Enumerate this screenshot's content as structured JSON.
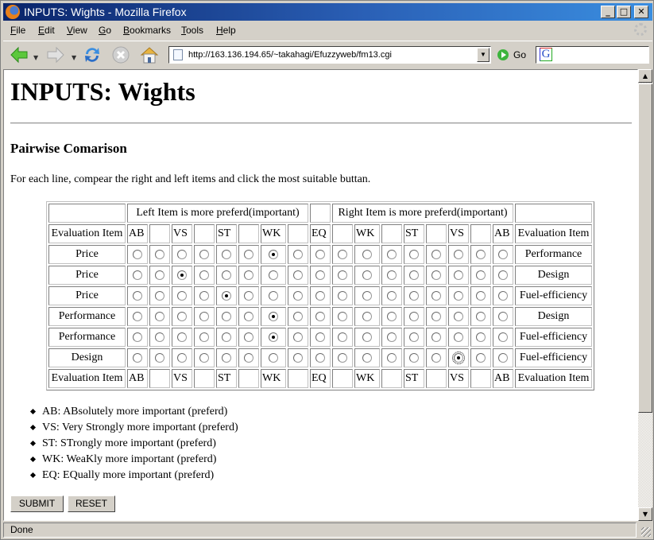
{
  "window": {
    "title": "INPUTS: Wights - Mozilla Firefox",
    "controls": {
      "minimize": "_",
      "maximize": "□",
      "close": "✕"
    }
  },
  "menu": [
    "File",
    "Edit",
    "View",
    "Go",
    "Bookmarks",
    "Tools",
    "Help"
  ],
  "toolbar": {
    "url": "http://163.136.194.65/~takahagi/Efuzzyweb/fm13.cgi",
    "go_label": "Go",
    "search_value": "",
    "icons": [
      "back-icon",
      "forward-icon",
      "reload-icon",
      "stop-icon",
      "home-icon"
    ]
  },
  "page": {
    "heading": "INPUTS: Wights",
    "subheading": "Pairwise Comarison",
    "intro": "For each line, compear the right and left items and click the most suitable buttan.",
    "table": {
      "left_header": "Left Item is more preferd(important)",
      "right_header": "Right Item is more preferd(important)",
      "item_col_label": "Evaluation Item",
      "levels": [
        "AB",
        "",
        "VS",
        "",
        "ST",
        "",
        "WK",
        "",
        "EQ",
        "",
        "WK",
        "",
        "ST",
        "",
        "VS",
        "",
        "AB"
      ],
      "rows": [
        {
          "left": "Price",
          "right": "Performance",
          "selected": 6,
          "focused": false
        },
        {
          "left": "Price",
          "right": "Design",
          "selected": 2,
          "focused": false
        },
        {
          "left": "Price",
          "right": "Fuel-efficiency",
          "selected": 4,
          "focused": false
        },
        {
          "left": "Performance",
          "right": "Design",
          "selected": 6,
          "focused": false
        },
        {
          "left": "Performance",
          "right": "Fuel-efficiency",
          "selected": 6,
          "focused": false
        },
        {
          "left": "Design",
          "right": "Fuel-efficiency",
          "selected": 14,
          "focused": true
        }
      ]
    },
    "legend": [
      "AB: ABsolutely more important (preferd)",
      "VS: Very Strongly more important (preferd)",
      "ST: STrongly more important (preferd)",
      "WK: WeaKly more important (preferd)",
      "EQ: EQually more important (preferd)"
    ],
    "submit_label": "SUBMIT",
    "reset_label": "RESET"
  },
  "status": "Done"
}
